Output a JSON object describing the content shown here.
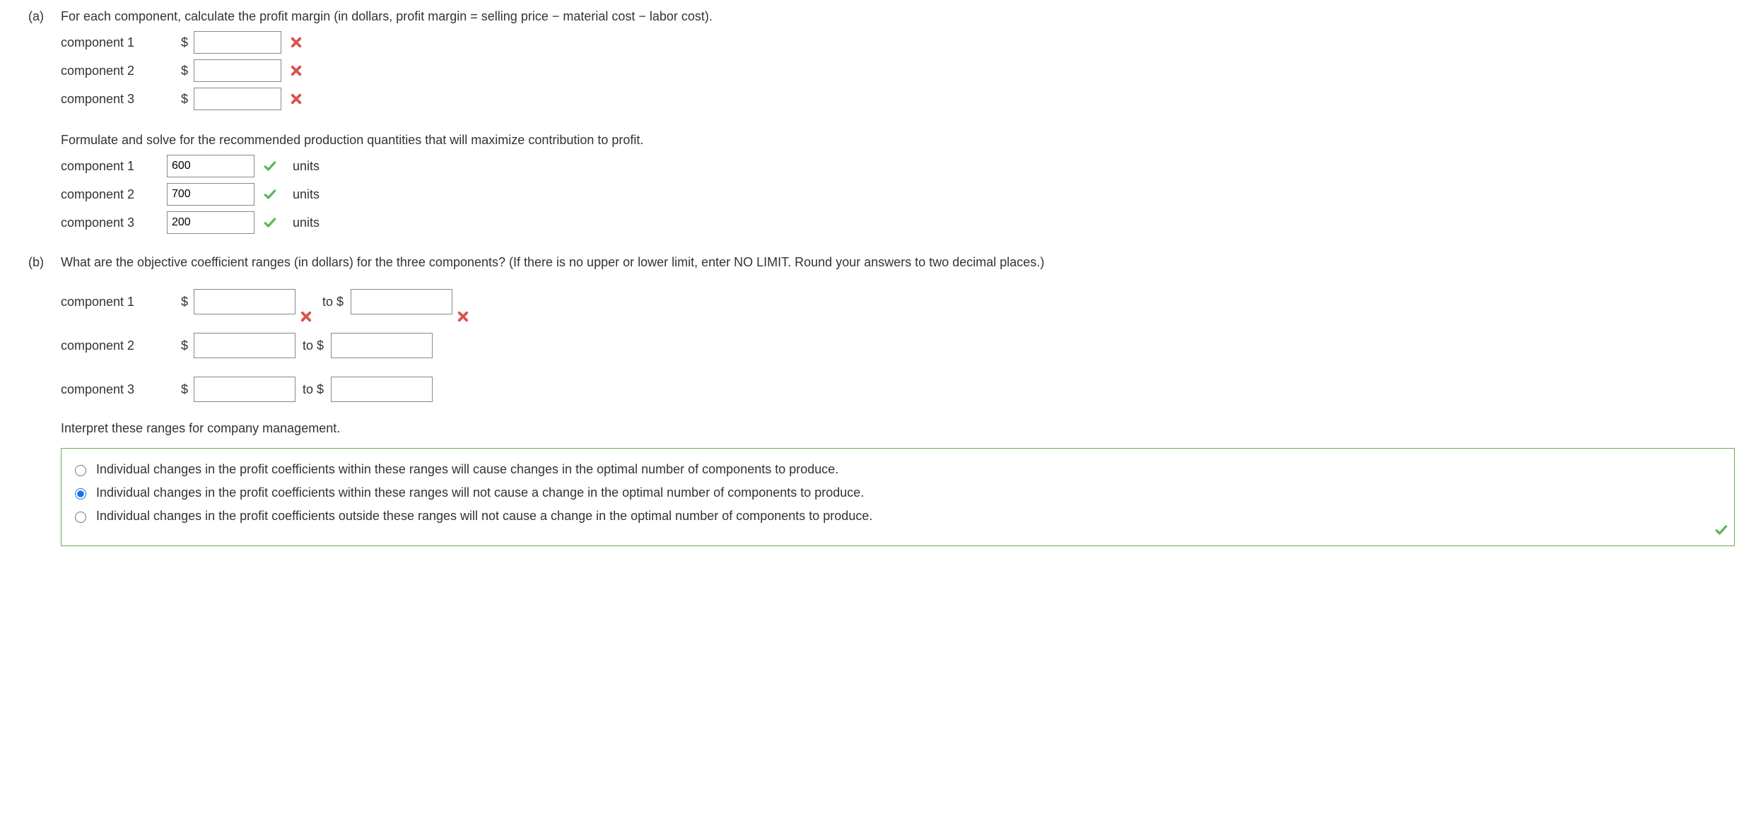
{
  "partA": {
    "label": "(a)",
    "prompt": "For each component, calculate the profit margin (in dollars, profit margin = selling price − material cost − labor cost).",
    "profit_rows": [
      {
        "label": "component 1",
        "currency": "$",
        "value": "",
        "status": "x"
      },
      {
        "label": "component 2",
        "currency": "$",
        "value": "",
        "status": "x"
      },
      {
        "label": "component 3",
        "currency": "$",
        "value": "",
        "status": "x"
      }
    ],
    "prompt2": "Formulate and solve for the recommended production quantities that will maximize contribution to profit.",
    "qty_rows": [
      {
        "label": "component 1",
        "value": "600",
        "unit": "units",
        "status": "check"
      },
      {
        "label": "component 2",
        "value": "700",
        "unit": "units",
        "status": "check"
      },
      {
        "label": "component 3",
        "value": "200",
        "unit": "units",
        "status": "check"
      }
    ]
  },
  "partB": {
    "label": "(b)",
    "prompt": "What are the objective coefficient ranges (in dollars) for the three components? (If there is no upper or lower limit, enter NO LIMIT. Round your answers to two decimal places.)",
    "range_rows": [
      {
        "label": "component 1",
        "currency": "$",
        "low": "",
        "to": "to $",
        "high": "",
        "status_low": "x",
        "status_high": "x"
      },
      {
        "label": "component 2",
        "currency": "$",
        "low": "",
        "to": "to $",
        "high": "",
        "status_low": "",
        "status_high": ""
      },
      {
        "label": "component 3",
        "currency": "$",
        "low": "",
        "to": "to $",
        "high": "",
        "status_low": "",
        "status_high": ""
      }
    ],
    "interpret_prompt": "Interpret these ranges for company management.",
    "options": [
      {
        "text": "Individual changes in the profit coefficients within these ranges will cause changes in the optimal number of components to produce.",
        "selected": false
      },
      {
        "text": "Individual changes in the profit coefficients within these ranges will not cause a change in the optimal number of components to produce.",
        "selected": true
      },
      {
        "text": "Individual changes in the profit coefficients outside these ranges will not cause a change in the optimal number of components to produce.",
        "selected": false
      }
    ],
    "mc_status": "check"
  }
}
